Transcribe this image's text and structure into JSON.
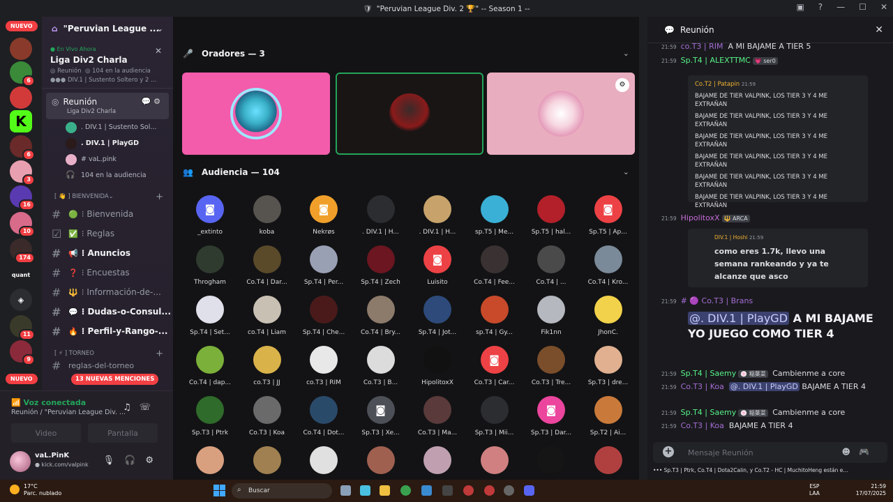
{
  "window": {
    "title": "\"Peruvian League Div. 2 🏆\" -- Season 1 --"
  },
  "servers": {
    "nuevo_top": "NUEVO",
    "nuevo_bottom": "NUEVO",
    "badges": [
      "6",
      "6",
      "3",
      "16",
      "10",
      "174",
      "11",
      "9"
    ],
    "quantum_label": "quant"
  },
  "sidebar": {
    "guild_name": "\"Peruvian League ...",
    "stage": {
      "live_label": "En Vivo Ahora",
      "title": "Liga Div2 Charla",
      "meta_channel": "Reunión",
      "meta_audience": "104 en la audiencia",
      "speakers_preview": "DIV.1 | Sustento Soltero y 2 ..."
    },
    "current_channel": {
      "name": "Reunión",
      "subtitle": "Liga Div2 Charla"
    },
    "voice_users": [
      {
        "name": ". DIV.1 | Sustento Sol..."
      },
      {
        "name": ". DIV.1 | PlayGD"
      },
      {
        "name": "# vaL.pink"
      },
      {
        "name": "104 en la audiencia"
      }
    ],
    "category_bienvenida": "[ 👋 ] BIENVENIDA",
    "channels": [
      {
        "emoji": "🟢",
        "name": "⁝ Bienvenida"
      },
      {
        "emoji": "✅",
        "name": "⁝ Reglas"
      },
      {
        "emoji": "📢",
        "name": "⁝ Anuncios"
      },
      {
        "emoji": "❓",
        "name": "⁝ Encuestas"
      },
      {
        "emoji": "🔱",
        "name": "⁝ Información-de-..."
      },
      {
        "emoji": "💬",
        "name": "⁝ Dudas-o-Consul..."
      },
      {
        "emoji": "🔥",
        "name": "⁝ Perfil-y-Rango-..."
      }
    ],
    "category_torneo": "[ ⚡ ] TORNEO",
    "channel_reglas_torneo": "reglas-del-torneo",
    "mentions_pill": "13 NUEVAS MENCIONES",
    "voice": {
      "status": "Voz conectada",
      "location": "Reunión / \"Peruvian League Div. ...",
      "video_label": "Video",
      "screen_label": "Pantalla"
    },
    "user": {
      "name": "vaL.PinK",
      "status": "kick.com/valpink"
    }
  },
  "stage_area": {
    "speakers_header": "Oradores — 3",
    "audience_header": "Audiencia — 104",
    "speaker_tiles": [
      {
        "bg": "#f35bab"
      },
      {
        "bg": "#1a1515"
      },
      {
        "bg": "#e9adc0"
      }
    ],
    "audience": [
      {
        "label": "_extinto",
        "color": "#5865f2",
        "icon": "discord-icon"
      },
      {
        "label": "koba",
        "color": "#57534f"
      },
      {
        "label": "Nekrøs",
        "color": "#f0a02a",
        "icon": "discord-icon"
      },
      {
        "label": ". DIV.1 | H...",
        "color": "#2b2d31"
      },
      {
        "label": ". DIV.1 | H...",
        "color": "#c7a36b"
      },
      {
        "label": "sp.T5 | Me...",
        "color": "#3ab0d6"
      },
      {
        "label": "Sp.T5 | hal...",
        "color": "#b3202a"
      },
      {
        "label": "Sp.T5 | Ap...",
        "color": "#ed4245",
        "icon": "discord-icon"
      },
      {
        "label": "Throgham",
        "color": "#2f3b2f"
      },
      {
        "label": "Co.T4 | Dar...",
        "color": "#5a4a2a"
      },
      {
        "label": "Sp.T4 | Per...",
        "color": "#9aa0b4"
      },
      {
        "label": "Sp.T4 | Zech",
        "color": "#6b1620"
      },
      {
        "label": "Luisito",
        "color": "#ed4245",
        "icon": "discord-icon"
      },
      {
        "label": "Co.T4 | Fee...",
        "color": "#3a3232"
      },
      {
        "label": "Co.T4 | ...",
        "color": "#4a4a4a"
      },
      {
        "label": "Co.T4 | Kro...",
        "color": "#7b8a99"
      },
      {
        "label": "Sp.T4 | Set...",
        "color": "#e0e0ea"
      },
      {
        "label": "co.T4 | Liam",
        "color": "#c9c0b4"
      },
      {
        "label": "Sp.T4 | Che...",
        "color": "#4a1a1a"
      },
      {
        "label": "Co.T4 | Bry...",
        "color": "#8c7a6b"
      },
      {
        "label": "Sp.T4 | Jot...",
        "color": "#2d4a7a"
      },
      {
        "label": "sp.T4 | Gy...",
        "color": "#c84a2a"
      },
      {
        "label": "Fik1nn",
        "color": "#b5b8bf"
      },
      {
        "label": "JhonC.",
        "color": "#f2d24a"
      },
      {
        "label": "Co.T4 | dap...",
        "color": "#7bb03a"
      },
      {
        "label": "co.T3 | JJ",
        "color": "#d9b24a"
      },
      {
        "label": "co.T3 | RIM",
        "color": "#e8e8e8"
      },
      {
        "label": "Co.T3 | B...",
        "color": "#dcdcdc"
      },
      {
        "label": "HipolitoxX",
        "color": "#111111"
      },
      {
        "label": "Co.T3 | Car...",
        "color": "#ed4245",
        "icon": "discord-icon"
      },
      {
        "label": "Co.T3 | Tre...",
        "color": "#7a4e2a"
      },
      {
        "label": "Sp.T3 | dre...",
        "color": "#e0b090"
      },
      {
        "label": "Sp.T3 | Ptrk",
        "color": "#2f6b2a"
      },
      {
        "label": "Co.T3 | Koa",
        "color": "#6a6a6a"
      },
      {
        "label": "Co.T4 | Dot...",
        "color": "#2a4a6a"
      },
      {
        "label": "Sp.T3 | Xe...",
        "color": "#4e5058",
        "icon": "discord-icon"
      },
      {
        "label": "Co.T3 | Ma...",
        "color": "#5a3a3a"
      },
      {
        "label": "Sp.T3 | Mii...",
        "color": "#2b2d31"
      },
      {
        "label": "Sp.T3 | Dar...",
        "color": "#eb459e",
        "icon": "discord-icon"
      },
      {
        "label": "Sp.T2 | Ai...",
        "color": "#c97a3a"
      },
      {
        "label": "",
        "color": "#d9a080"
      },
      {
        "label": "",
        "color": "#a08050"
      },
      {
        "label": "",
        "color": "#e0e0e0"
      },
      {
        "label": "",
        "color": "#a06050"
      },
      {
        "label": "",
        "color": "#c0a0b0"
      },
      {
        "label": "",
        "color": "#d08080"
      },
      {
        "label": "",
        "color": "#151515"
      },
      {
        "label": "",
        "color": "#b04040"
      }
    ]
  },
  "chat": {
    "header": "Reunión",
    "messages": [
      {
        "time": "21:59",
        "author": "co.T3 | RIM",
        "text": "A MI BAJAME A TIER 5"
      },
      {
        "time": "21:59",
        "author": "Sp.T4 | ALEXTTMC",
        "tag": "💗 ser0"
      },
      {
        "time": "21:59",
        "author": "HipolitoxX",
        "tag": "🔱 ARCA"
      },
      {
        "time": "21:59",
        "author": "# 🟣 Co.T3 | Brans"
      },
      {
        "time": "21:59",
        "author": "Sp.T4 | Saemy",
        "tag": "🍥 稲葉菜",
        "text": "Cambienme a core"
      },
      {
        "time": "21:59",
        "author": "Co.T3 | Koa",
        "text_mention": "@. DIV.1 | PlayGD",
        "text": "BAJAME A TIER 4"
      },
      {
        "time": "21:59",
        "author": "Sp.T4 | Saemy",
        "tag": "🍥 稲葉菜",
        "text": "Cambienme a core"
      },
      {
        "time": "21:59",
        "author": "Co.T3 | Koa",
        "text": "BAJAME A TIER 4"
      }
    ],
    "embed1": {
      "author": "Co.T2 | Patapin",
      "time": "21:59",
      "lines": [
        "BAJAME DE TIER VALPINK, LOS TIER 3 Y 4 ME EXTRAÑAN",
        "BAJAME DE TIER VALPINK, LOS TIER 3 Y 4 ME EXTRAÑAN",
        "BAJAME DE TIER VALPINK, LOS TIER 3 Y 4 ME EXTRAÑAN",
        "BAJAME DE TIER VALPINK, LOS TIER 3 Y 4 ME EXTRAÑAN",
        "BAJAME DE TIER VALPINK, LOS TIER 3 Y 4 ME EXTRAÑAN",
        "BAJAME DE TIER VALPINK, LOS TIER 3 Y 4 ME EXTRAÑAN"
      ]
    },
    "embed2": {
      "author": "DIV.1 | Hoshi",
      "time": "21:59",
      "text": "como eres 1.7k, llevo una semana rankeando y ya te alcanze que asco"
    },
    "big_mention": "@. DIV.1 | PlayGD",
    "big_text": "A MI BAJAME YO JUEGO COMO TIER 4",
    "input_placeholder": "Mensaje Reunión",
    "typing": "Sp.T3 | Ptrk, Co.T4 | Dota2Calin, y Co.T2 - HC | MuchitoHeng están e..."
  },
  "taskbar": {
    "weather_temp": "17°C",
    "weather_desc": "Parc. nublado",
    "search": "Buscar",
    "lang": "ESP",
    "lang_sub": "LAA",
    "time": "21:59",
    "date": "17/07/2025"
  }
}
